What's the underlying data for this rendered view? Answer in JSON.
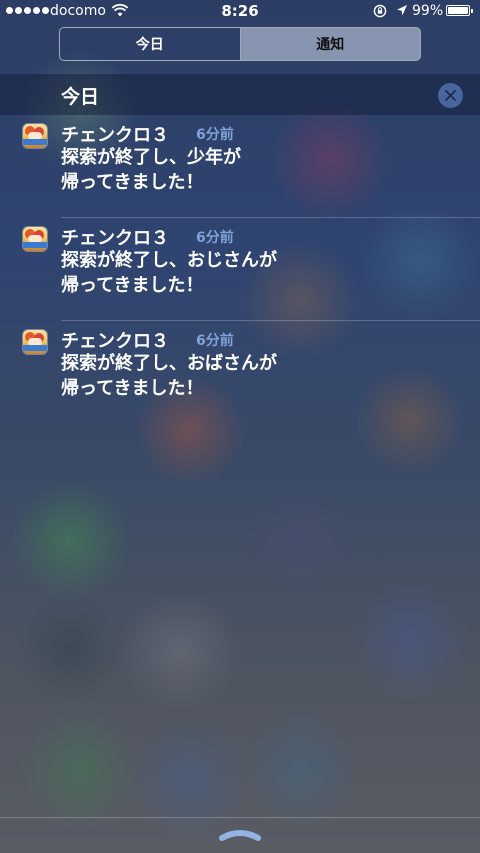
{
  "status_bar": {
    "carrier": "docomo",
    "time": "8:26",
    "battery_percent": "99%",
    "battery_level": 0.99,
    "icons": [
      "signal-dots",
      "wifi-icon",
      "rotation-lock-icon",
      "location-arrow-icon",
      "battery-icon"
    ]
  },
  "segments": {
    "today_label": "今日",
    "notifications_label": "通知",
    "selected": "notifications"
  },
  "section": {
    "title": "今日",
    "clear_icon": "close-icon"
  },
  "notifications": [
    {
      "app": "チェンクロ３",
      "time_ago": "6分前",
      "message": "探索が終了し、少年が\n帰ってきました！"
    },
    {
      "app": "チェンクロ３",
      "time_ago": "6分前",
      "message": "探索が終了し、おじさんが\n帰ってきました！"
    },
    {
      "app": "チェンクロ３",
      "time_ago": "6分前",
      "message": "探索が終了し、おばさんが\n帰ってきました！"
    }
  ],
  "colors": {
    "accent_time": "#7fa3d9",
    "clear_button": "#506eaa",
    "selected_segment": "#d2dceb"
  }
}
